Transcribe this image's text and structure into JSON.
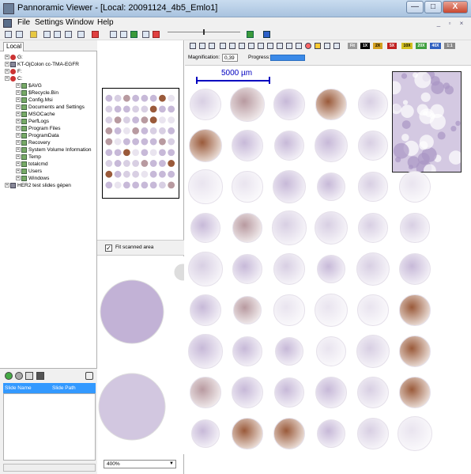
{
  "window": {
    "title": "Pannoramic Viewer - [Local: 20091124_4b5_Emlo1]",
    "min_label": "—",
    "max_label": "□",
    "close_label": "X"
  },
  "menu": {
    "items": [
      "File",
      "Settings",
      "Window",
      "Help"
    ],
    "mdi_min": "_",
    "mdi_restore": "▫",
    "mdi_close": "×"
  },
  "left_panel": {
    "tab_label": "Local",
    "tree": [
      {
        "label": "G:",
        "type": "drive"
      },
      {
        "label": "KT-OjColon cc-TMA-EGFR",
        "type": "hdd"
      },
      {
        "label": "F:",
        "type": "drive"
      },
      {
        "label": "C:",
        "type": "drive"
      },
      {
        "label": "$AVG",
        "type": "folder"
      },
      {
        "label": "$Recycle.Bin",
        "type": "folder"
      },
      {
        "label": "Config.Msi",
        "type": "folder"
      },
      {
        "label": "Documents and Settings",
        "type": "folder"
      },
      {
        "label": "MSOCache",
        "type": "folder"
      },
      {
        "label": "PerfLogs",
        "type": "folder"
      },
      {
        "label": "Program Files",
        "type": "folder"
      },
      {
        "label": "ProgramData",
        "type": "folder"
      },
      {
        "label": "Recovery",
        "type": "folder"
      },
      {
        "label": "System Volume Information",
        "type": "folder"
      },
      {
        "label": "Temp",
        "type": "folder"
      },
      {
        "label": "totalcmd",
        "type": "folder"
      },
      {
        "label": "Users",
        "type": "folder"
      },
      {
        "label": "Windows",
        "type": "folder"
      },
      {
        "label": "HER2 test slides gépen",
        "type": "hdd"
      }
    ],
    "slide_columns": [
      "Slide Name",
      "Slide Path"
    ]
  },
  "nav_panel": {
    "fit_label": "Fit scanned area",
    "fit_checked": "✓",
    "zoom_value": "400%"
  },
  "viewer_toolbar": {
    "magnifications": [
      "Fit",
      "1X",
      "2X",
      "5X",
      "10X",
      "20X",
      "40X",
      "1:1"
    ],
    "mag_colors": [
      "#9a9a9a",
      "#000000",
      "#d4a020",
      "#c02020",
      "#d4c020",
      "#40a040",
      "#3060c0",
      "#888888"
    ],
    "magnification_label": "Magnification:",
    "magnification_value": "0,39",
    "progress_label": "Progress:"
  },
  "viewer": {
    "scalebar_label": "5000 µm"
  }
}
